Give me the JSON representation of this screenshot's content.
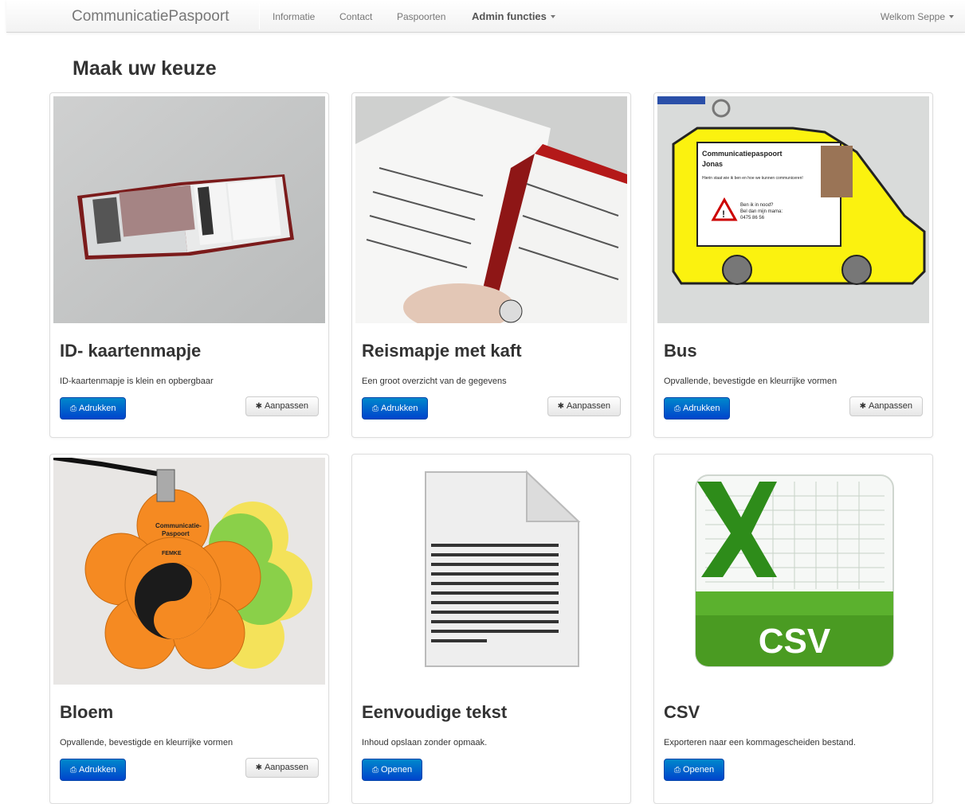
{
  "navbar": {
    "brand": "CommunicatiePaspoort",
    "links": [
      "Informatie",
      "Contact",
      "Paspoorten"
    ],
    "admin": "Admin functies",
    "welcome": "Welkom Seppe"
  },
  "page_title": "Maak uw keuze",
  "cards": [
    {
      "title": "ID- kaartenmapje",
      "desc": "ID-kaartenmapje is klein en opbergbaar",
      "primary": "Adrukken",
      "secondary": "Aanpassen"
    },
    {
      "title": "Reismapje met kaft",
      "desc": "Een groot overzicht van de gegevens",
      "primary": "Adrukken",
      "secondary": "Aanpassen"
    },
    {
      "title": "Bus",
      "desc": "Opvallende, bevestigde en kleurrijke vormen",
      "primary": "Adrukken",
      "secondary": "Aanpassen",
      "image_text": {
        "line1": "Communicatiepaspoort",
        "line2": "Jonas",
        "line3": "Hierin staat wie ik ben en hoe we kunnen communiceren!",
        "line4": "Ben ik in nood?",
        "line5": "Bel dan mijn mama:",
        "line6": "0475 86 56"
      }
    },
    {
      "title": "Bloem",
      "desc": "Opvallende, bevestigde en kleurrijke vormen",
      "primary": "Adrukken",
      "secondary": "Aanpassen",
      "image_text": {
        "line1": "Communicatie-",
        "line2": "Paspoort",
        "line3": "FEMKE"
      }
    },
    {
      "title": "Eenvoudige tekst",
      "desc": "Inhoud opslaan zonder opmaak.",
      "primary": "Openen"
    },
    {
      "title": "CSV",
      "desc": "Exporteren naar een kommagescheiden bestand.",
      "primary": "Openen",
      "image_text": {
        "label": "CSV"
      }
    }
  ],
  "icons": {
    "print": "print-icon",
    "settings": "gear-icon"
  }
}
